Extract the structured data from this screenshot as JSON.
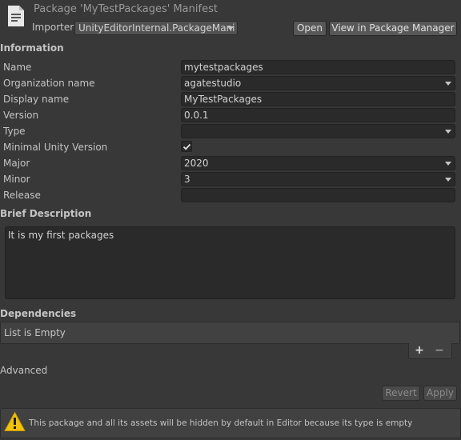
{
  "header": {
    "title": "Package 'MyTestPackages' Manifest",
    "importer_label": "Importer",
    "importer_value": "UnityEditorInternal.PackageMani",
    "open_label": "Open",
    "view_label": "View in Package Manager"
  },
  "information": {
    "section_title": "Information",
    "fields": {
      "name": {
        "label": "Name",
        "value": "mytestpackages"
      },
      "organization": {
        "label": "Organization name",
        "value": "agatestudio"
      },
      "display_name": {
        "label": "Display name",
        "value": "MyTestPackages"
      },
      "version": {
        "label": "Version",
        "value": "0.0.1"
      },
      "type": {
        "label": "Type",
        "value": ""
      },
      "minimal_unity": {
        "label": "Minimal Unity Version",
        "checked": true
      },
      "major": {
        "label": "Major",
        "value": "2020"
      },
      "minor": {
        "label": "Minor",
        "value": "3"
      },
      "release": {
        "label": "Release",
        "value": ""
      }
    }
  },
  "brief": {
    "section_title": "Brief Description",
    "value": "It is my first packages"
  },
  "dependencies": {
    "section_title": "Dependencies",
    "empty_text": "List is Empty",
    "add_symbol": "+",
    "remove_symbol": "−"
  },
  "advanced": {
    "section_title": "Advanced"
  },
  "actions": {
    "revert_label": "Revert",
    "apply_label": "Apply"
  },
  "help": {
    "icon": "warning-icon",
    "message": "This package and all its assets will be hidden by default in Editor because its type is empty"
  },
  "colors": {
    "background": "#383838",
    "field": "#2a2a2a",
    "warning": "#f4c20d"
  }
}
